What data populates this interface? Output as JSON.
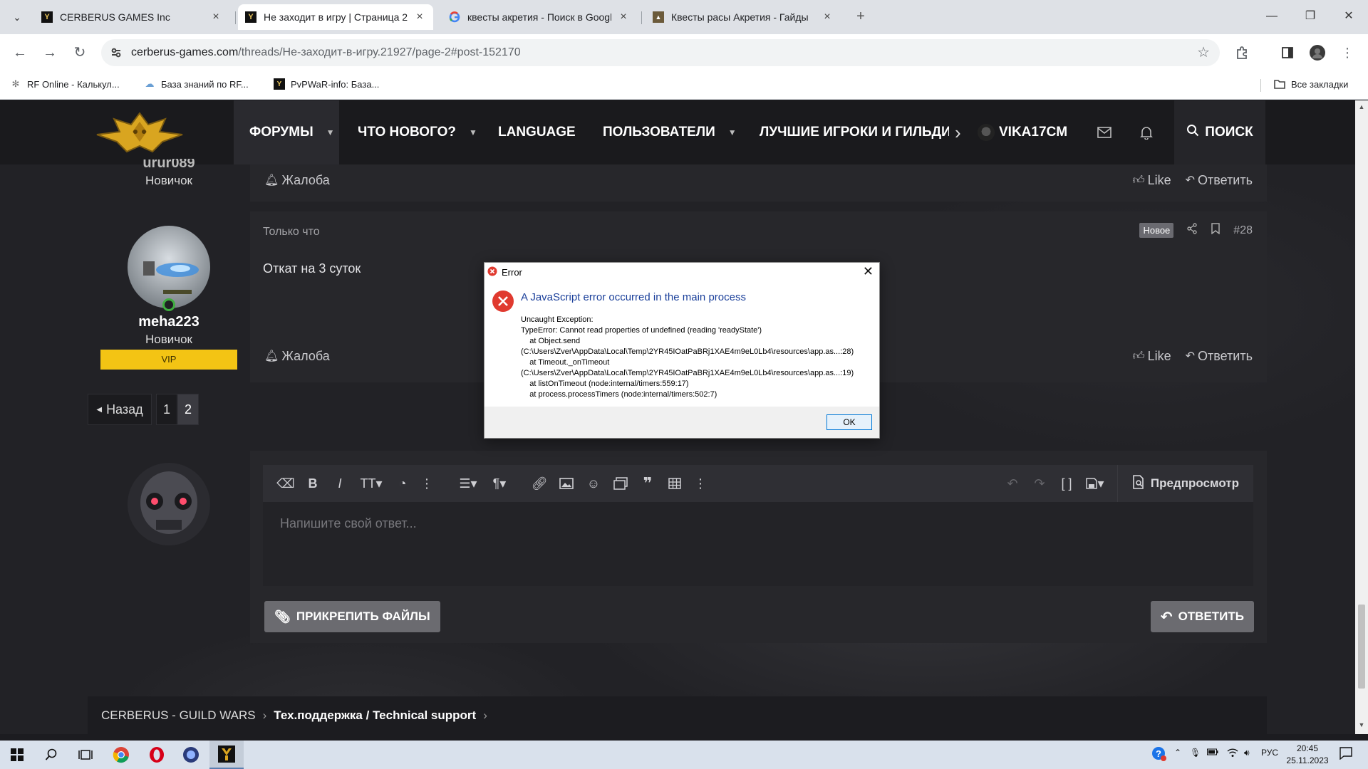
{
  "browser": {
    "tabs": [
      {
        "title": "CERBERUS GAMES Inc",
        "active": false
      },
      {
        "title": "Не заходит в игру | Страница 2",
        "active": true
      },
      {
        "title": "квесты акретия - Поиск в Google",
        "active": false
      },
      {
        "title": "Квесты расы Акретия - Гайды",
        "active": false
      }
    ],
    "url_domain": "cerberus-games.com",
    "url_path": "/threads/Не-заходит-в-игру.21927/page-2#post-152170",
    "bookmarks": [
      {
        "label": "RF Online - Калькул..."
      },
      {
        "label": "База знаний по RF..."
      },
      {
        "label": "PvPWaR-info: База..."
      }
    ],
    "all_bookmarks_label": "Все закладки"
  },
  "site": {
    "nav": {
      "forums": "ФОРУМЫ",
      "whats_new": "ЧТО НОВОГО?",
      "language": "LANGUAGE",
      "users": "ПОЛЬЗОВАТЕЛИ",
      "top_players": "ЛУЧШИЕ ИГРОКИ И ГИЛЬДИ",
      "username": "VIKA17CM",
      "search": "ПОИСК"
    },
    "prev_post": {
      "author_partial": "urur089",
      "role": "Новичок",
      "report": "Жалоба",
      "like": "Like",
      "reply": "Ответить"
    },
    "post": {
      "time": "Только что",
      "new_badge": "Новое",
      "number": "#28",
      "body": "Откат на 3 суток",
      "author": "meha223",
      "role": "Новичок",
      "badge": "VIP",
      "report": "Жалоба",
      "like": "Like",
      "reply": "Ответить"
    },
    "pagination": {
      "prev": "Назад",
      "pages": [
        "1",
        "2"
      ],
      "current": "2"
    },
    "editor": {
      "placeholder": "Напишите свой ответ...",
      "preview": "Предпросмотр",
      "attach": "ПРИКРЕПИТЬ ФАЙЛЫ",
      "submit": "ОТВЕТИТЬ"
    },
    "breadcrumbs": {
      "root": "CERBERUS - GUILD WARS",
      "section": "Тех.поддержка / Technical support"
    }
  },
  "dialog": {
    "title": "Error",
    "heading": "A JavaScript error occurred in the main process",
    "body": "Uncaught Exception:\nTypeError: Cannot read properties of undefined (reading 'readyState')\n    at Object.send\n(C:\\Users\\Zver\\AppData\\Local\\Temp\\2YR45IOatPaBRj1XAE4m9eL0Lb4\\resources\\app.as...:28)\n    at Timeout._onTimeout\n(C:\\Users\\Zver\\AppData\\Local\\Temp\\2YR45IOatPaBRj1XAE4m9eL0Lb4\\resources\\app.as...:19)\n    at listOnTimeout (node:internal/timers:559:17)\n    at process.processTimers (node:internal/timers:502:7)",
    "ok": "OK"
  },
  "taskbar": {
    "lang": "РУС",
    "time": "20:45",
    "date": "25.11.2023"
  },
  "colors": {
    "site_bg": "#1f1f23",
    "card_bg": "#27272b",
    "vip": "#f3c414",
    "dialog_heading": "#1a3f9a",
    "error_red": "#e03a2f"
  }
}
